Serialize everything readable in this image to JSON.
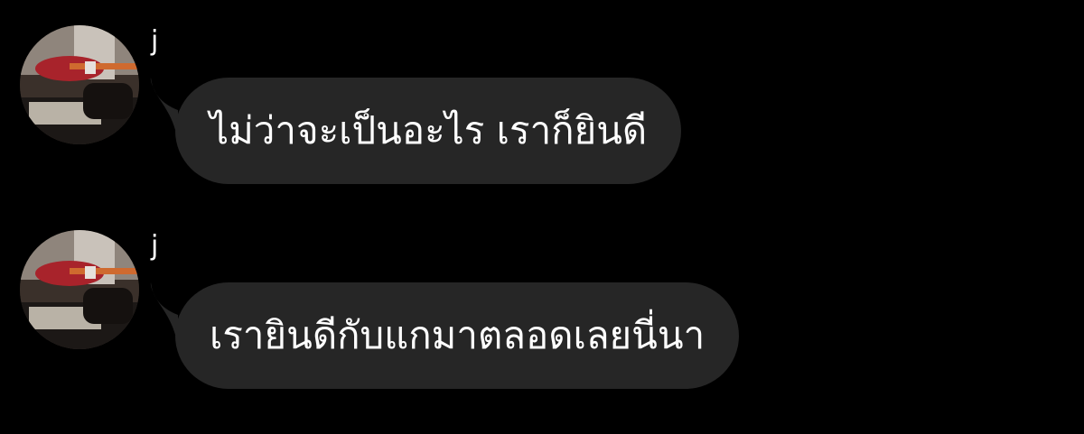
{
  "conversation": {
    "messages": [
      {
        "sender": "j",
        "avatar_icon": "avatar-photo-guitar-icon",
        "text": "ไม่ว่าจะเป็นอะไร เราก็ยินดี"
      },
      {
        "sender": "j",
        "avatar_icon": "avatar-photo-guitar-icon",
        "text": "เรายินดีกับแกมาตลอดเลยนี่นา"
      }
    ]
  },
  "colors": {
    "background": "#000000",
    "bubble": "#262626",
    "text": "#ffffff"
  }
}
